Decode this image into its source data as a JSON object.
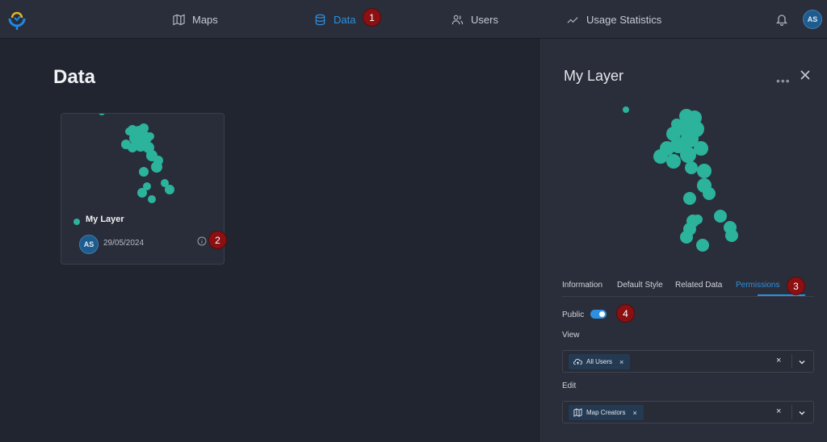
{
  "nav": {
    "items": [
      {
        "label": "Maps",
        "icon": "map-icon"
      },
      {
        "label": "Data",
        "icon": "database-icon",
        "active": true
      },
      {
        "label": "Users",
        "icon": "users-icon"
      },
      {
        "label": "Usage Statistics",
        "icon": "activity-icon"
      }
    ],
    "user_initials": "AS"
  },
  "badges": [
    "1",
    "2",
    "3",
    "4"
  ],
  "page": {
    "title": "Data"
  },
  "card": {
    "name": "My Layer",
    "owner_initials": "AS",
    "date": "29/05/2024"
  },
  "panel": {
    "title": "My Layer",
    "tabs": [
      "Information",
      "Default Style",
      "Related Data",
      "Permissions"
    ],
    "active_tab": "Permissions",
    "public_label": "Public",
    "public_enabled": true,
    "view_label": "View",
    "view_chip": "All Users",
    "edit_label": "Edit",
    "edit_chip": "Map Creators"
  },
  "colors": {
    "accent": "#2e8fe0",
    "layer": "#2bb39c",
    "badge": "#8b1012"
  }
}
